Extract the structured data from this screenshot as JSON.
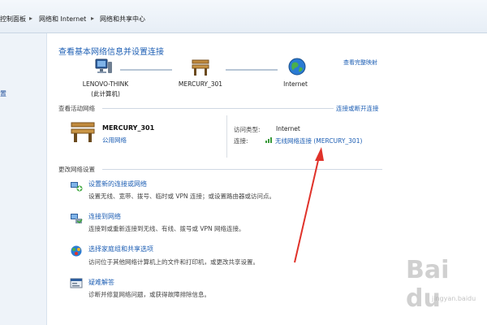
{
  "breadcrumb": {
    "items": [
      "控制面板",
      "网络和 Internet",
      "网络和共享中心"
    ],
    "separator": "▸"
  },
  "left_pane": {
    "fragment": "置"
  },
  "header": {
    "title": "查看基本网络信息并设置连接",
    "full_map_link": "查看完整映射"
  },
  "network_map": {
    "nodes": [
      {
        "label": "LENOVO-THINK",
        "sublabel": "(此计算机)",
        "icon": "computer-icon"
      },
      {
        "label": "MERCURY_301",
        "sublabel": "",
        "icon": "bench-icon"
      },
      {
        "label": "Internet",
        "sublabel": "",
        "icon": "globe-icon"
      }
    ]
  },
  "active_networks": {
    "heading": "查看活动网络",
    "action_link": "连接或断开连接",
    "network_name": "MERCURY_301",
    "network_type": "公用网络",
    "access_type_label": "访问类型:",
    "access_type_value": "Internet",
    "connection_label": "连接:",
    "connection_value": "无线网络连接 (MERCURY_301)"
  },
  "change_settings": {
    "heading": "更改网络设置",
    "tasks": [
      {
        "link": "设置新的连接或网络",
        "desc": "设置无线、宽带、拨号、临时或 VPN 连接；或设置路由器或访问点。",
        "icon": "new-connection-icon"
      },
      {
        "link": "连接到网络",
        "desc": "连接到或重新连接到无线、有线、拨号或 VPN 网络连接。",
        "icon": "connect-network-icon"
      },
      {
        "link": "选择家庭组和共享选项",
        "desc": "访问位于其他网络计算机上的文件和打印机，或更改共享设置。",
        "icon": "homegroup-icon"
      },
      {
        "link": "疑难解答",
        "desc": "诊断并修复网络问题，或获得故障排除信息。",
        "icon": "troubleshoot-icon"
      }
    ]
  },
  "watermark": {
    "text": "Bai du",
    "sub": "jingyan.baidu"
  },
  "colors": {
    "link": "#1e5fb4",
    "arrow": "#e0322a",
    "breadcrumb_bg": "#e7eef6"
  }
}
